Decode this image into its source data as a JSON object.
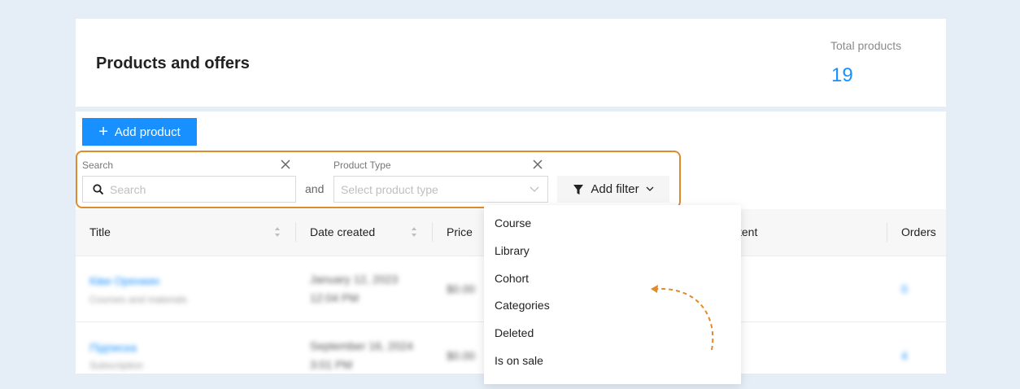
{
  "header": {
    "title": "Products and offers",
    "total_label": "Total products",
    "total_value": "19"
  },
  "toolbar": {
    "add_product_label": "Add product"
  },
  "filters": {
    "search_label": "Search",
    "search_placeholder": "Search",
    "conjunction": "and",
    "product_type_label": "Product Type",
    "product_type_placeholder": "Select product type",
    "add_filter_label": "Add filter"
  },
  "table": {
    "columns": [
      "Title",
      "Date created",
      "Price",
      "tent",
      "Orders"
    ],
    "rows": [
      {
        "title": "Ківи Оренкин",
        "subtitle": "Courses and materials",
        "date": "January 12, 2023",
        "time": "12:04 PM",
        "price": "$0.00",
        "orders": "0"
      },
      {
        "title": "Підписка",
        "subtitle": "Subscription",
        "date": "September 16, 2024",
        "time": "3:01 PM",
        "price": "$0.00",
        "orders": "4"
      }
    ]
  },
  "dropdown": {
    "items": [
      "Course",
      "Library",
      "Cohort",
      "Categories",
      "Deleted",
      "Is on sale"
    ]
  },
  "colors": {
    "accent": "#1890ff",
    "highlight": "#e08a2e",
    "background": "#e5edf7"
  }
}
